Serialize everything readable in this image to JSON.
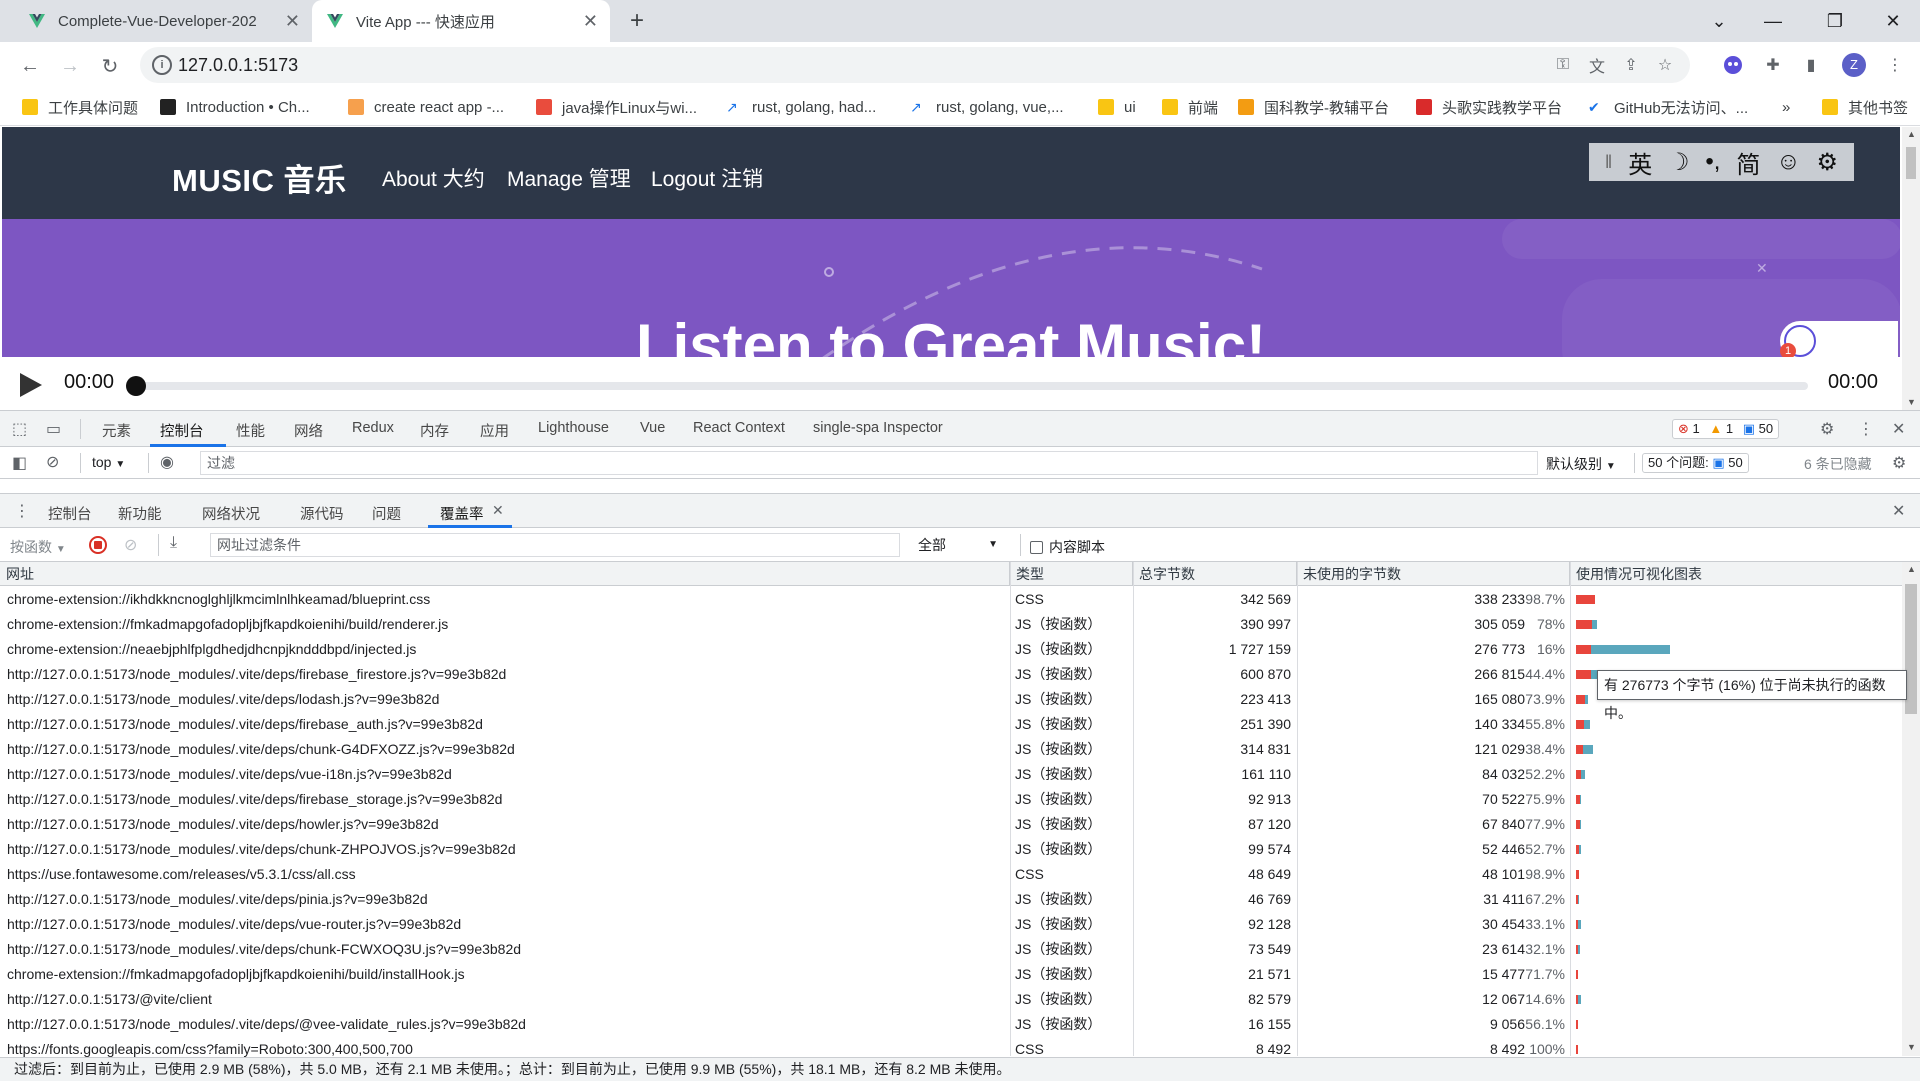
{
  "browser": {
    "tabs": [
      {
        "title": "Complete-Vue-Developer-202",
        "active": false
      },
      {
        "title": "Vite App --- 快速应用",
        "active": true
      }
    ],
    "url": "127.0.0.1:5173",
    "bookmarks": [
      "工作具体问题",
      "Introduction • Ch...",
      "create react app -...",
      "java操作Linux与wi...",
      "rust, golang, had...",
      "rust, golang, vue,...",
      "ui",
      "前端",
      "国科教学-教辅平台",
      "头歌实践教学平台",
      "GitHub无法访问、...",
      "»",
      "其他书签"
    ],
    "profile_initial": "Z"
  },
  "site": {
    "brand": "MUSIC 音乐",
    "nav": [
      "About 大约",
      "Manage 管理",
      "Logout 注销"
    ],
    "ext_toolbar": [
      "英",
      "☽",
      "•,",
      "简",
      "☺",
      "⚙"
    ],
    "hero_title": "Listen to Great Music!",
    "player": {
      "current_time": "00:00",
      "duration": "00:00"
    },
    "notification_count": "1"
  },
  "devtools": {
    "main_tabs": [
      "元素",
      "控制台",
      "性能",
      "网络",
      "Redux",
      "内存",
      "应用",
      "Lighthouse",
      "Vue",
      "React Context",
      "single-spa Inspector"
    ],
    "active_main_tab": "控制台",
    "errors": "1",
    "warnings": "1",
    "messages": "50",
    "console_toolbar": {
      "context": "top",
      "filter_placeholder": "过滤",
      "level": "默认级别",
      "issues_label": "50 个问题:",
      "issues_count": "50",
      "hidden": "6 条已隐藏"
    },
    "drawer_tabs": [
      "控制台",
      "新功能",
      "网络状况",
      "源代码",
      "问题",
      "覆盖率"
    ],
    "active_drawer_tab": "覆盖率",
    "coverage_toolbar": {
      "granularity": "按函数",
      "url_filter_placeholder": "网址过滤条件",
      "type_filter": "全部",
      "content_scripts": "内容脚本"
    },
    "coverage_columns": [
      "网址",
      "类型",
      "总字节数",
      "未使用的字节数",
      "使用情况可视化图表"
    ],
    "coverage_rows": [
      {
        "url": "chrome-extension://ikhdkkncnoglghljlkmcimlnlhkeamad/blueprint.css",
        "type": "CSS",
        "total": "342 569",
        "unused": "338 233",
        "pct": "98.7%",
        "unused_frac": 0.987,
        "bar": 0.198
      },
      {
        "url": "chrome-extension://fmkadmapgofadopljbjfkapdkoienihi/build/renderer.js",
        "type": "JS（按函数）",
        "total": "390 997",
        "unused": "305 059",
        "pct": "78%",
        "unused_frac": 0.78,
        "bar": 0.226
      },
      {
        "url": "chrome-extension://neaebjphlfplgdhedjdhcnpjkndddbpd/injected.js",
        "type": "JS（按函数）",
        "total": "1 727 159",
        "unused": "276 773",
        "pct": "16%",
        "unused_frac": 0.16,
        "bar": 1.0
      },
      {
        "url": "http://127.0.0.1:5173/node_modules/.vite/deps/firebase_firestore.js?v=99e3b82d",
        "type": "JS（按函数）",
        "total": "600 870",
        "unused": "266 815",
        "pct": "44.4%",
        "unused_frac": 0.444,
        "bar": 0.348
      },
      {
        "url": "http://127.0.0.1:5173/node_modules/.vite/deps/lodash.js?v=99e3b82d",
        "type": "JS（按函数）",
        "total": "223 413",
        "unused": "165 080",
        "pct": "73.9%",
        "unused_frac": 0.739,
        "bar": 0.129
      },
      {
        "url": "http://127.0.0.1:5173/node_modules/.vite/deps/firebase_auth.js?v=99e3b82d",
        "type": "JS（按函数）",
        "total": "251 390",
        "unused": "140 334",
        "pct": "55.8%",
        "unused_frac": 0.558,
        "bar": 0.146
      },
      {
        "url": "http://127.0.0.1:5173/node_modules/.vite/deps/chunk-G4DFXOZZ.js?v=99e3b82d",
        "type": "JS（按函数）",
        "total": "314 831",
        "unused": "121 029",
        "pct": "38.4%",
        "unused_frac": 0.384,
        "bar": 0.182
      },
      {
        "url": "http://127.0.0.1:5173/node_modules/.vite/deps/vue-i18n.js?v=99e3b82d",
        "type": "JS（按函数）",
        "total": "161 110",
        "unused": "84 032",
        "pct": "52.2%",
        "unused_frac": 0.522,
        "bar": 0.093
      },
      {
        "url": "http://127.0.0.1:5173/node_modules/.vite/deps/firebase_storage.js?v=99e3b82d",
        "type": "JS（按函数）",
        "total": "92 913",
        "unused": "70 522",
        "pct": "75.9%",
        "unused_frac": 0.759,
        "bar": 0.054
      },
      {
        "url": "http://127.0.0.1:5173/node_modules/.vite/deps/howler.js?v=99e3b82d",
        "type": "JS（按函数）",
        "total": "87 120",
        "unused": "67 840",
        "pct": "77.9%",
        "unused_frac": 0.779,
        "bar": 0.05
      },
      {
        "url": "http://127.0.0.1:5173/node_modules/.vite/deps/chunk-ZHPOJVOS.js?v=99e3b82d",
        "type": "JS（按函数）",
        "total": "99 574",
        "unused": "52 446",
        "pct": "52.7%",
        "unused_frac": 0.527,
        "bar": 0.058
      },
      {
        "url": "https://use.fontawesome.com/releases/v5.3.1/css/all.css",
        "type": "CSS",
        "total": "48 649",
        "unused": "48 101",
        "pct": "98.9%",
        "unused_frac": 0.989,
        "bar": 0.028
      },
      {
        "url": "http://127.0.0.1:5173/node_modules/.vite/deps/pinia.js?v=99e3b82d",
        "type": "JS（按函数）",
        "total": "46 769",
        "unused": "31 411",
        "pct": "67.2%",
        "unused_frac": 0.672,
        "bar": 0.027
      },
      {
        "url": "http://127.0.0.1:5173/node_modules/.vite/deps/vue-router.js?v=99e3b82d",
        "type": "JS（按函数）",
        "total": "92 128",
        "unused": "30 454",
        "pct": "33.1%",
        "unused_frac": 0.331,
        "bar": 0.053
      },
      {
        "url": "http://127.0.0.1:5173/node_modules/.vite/deps/chunk-FCWXOQ3U.js?v=99e3b82d",
        "type": "JS（按函数）",
        "total": "73 549",
        "unused": "23 614",
        "pct": "32.1%",
        "unused_frac": 0.321,
        "bar": 0.043
      },
      {
        "url": "chrome-extension://fmkadmapgofadopljbjfkapdkoienihi/build/installHook.js",
        "type": "JS（按函数）",
        "total": "21 571",
        "unused": "15 477",
        "pct": "71.7%",
        "unused_frac": 0.717,
        "bar": 0.012
      },
      {
        "url": "http://127.0.0.1:5173/@vite/client",
        "type": "JS（按函数）",
        "total": "82 579",
        "unused": "12 067",
        "pct": "14.6%",
        "unused_frac": 0.146,
        "bar": 0.048
      },
      {
        "url": "http://127.0.0.1:5173/node_modules/.vite/deps/@vee-validate_rules.js?v=99e3b82d",
        "type": "JS（按函数）",
        "total": "16 155",
        "unused": "9 056",
        "pct": "56.1%",
        "unused_frac": 0.561,
        "bar": 0.009
      },
      {
        "url": "https://fonts.googleapis.com/css?family=Roboto:300,400,500,700",
        "type": "CSS",
        "total": "8 492",
        "unused": "8 492",
        "pct": "100%",
        "unused_frac": 1.0,
        "bar": 0.005
      }
    ],
    "tooltip": "有 276773 个字节 (16%) 位于尚未执行的函数中。",
    "footer": "过滤后：到目前为止，已使用 2.9 MB (58%)，共 5.0 MB，还有 2.1 MB 未使用。；总计：到目前为止，已使用 9.9 MB (55%)，共 18.1 MB，还有 8.2 MB 未使用。"
  },
  "colors": {
    "header_bg": "#2d3748",
    "hero_bg": "#7d56c2",
    "unused_bar": "#e8453c",
    "used_bar": "#5aa7bd",
    "accent": "#1a73e8"
  }
}
